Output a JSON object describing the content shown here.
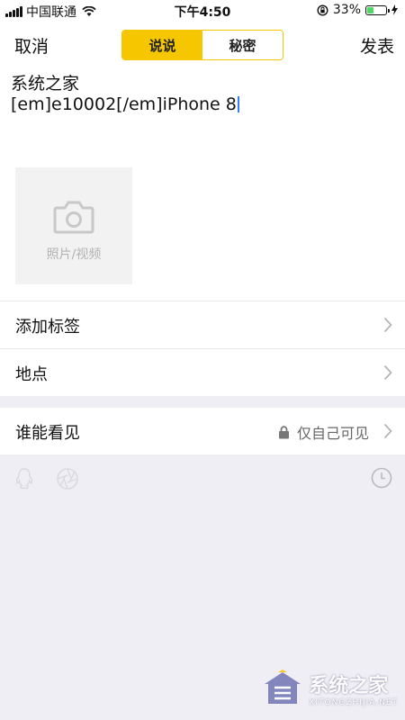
{
  "status_bar": {
    "carrier": "中国联通",
    "time": "下午4:50",
    "battery": "33%",
    "battery_level": 0.33
  },
  "nav": {
    "cancel": "取消",
    "publish": "发表",
    "tabs": [
      {
        "label": "说说"
      },
      {
        "label": "秘密"
      }
    ]
  },
  "compose": {
    "line1": "系统之家",
    "line2": "[em]e10002[/em]iPhone 8",
    "media_label": "照片/视频"
  },
  "rows": {
    "tags": {
      "label": "添加标签"
    },
    "location": {
      "label": "地点"
    },
    "visibility": {
      "label": "谁能看见",
      "value": "仅自己可见"
    }
  },
  "toolbar": {
    "icons": [
      "qq-icon",
      "aperture-icon",
      "clock-icon"
    ]
  },
  "watermark": {
    "cn": "系统之家",
    "en": "XITONGZHIJIA.NET"
  },
  "colors": {
    "accent": "#f6c700",
    "background": "#efeef4"
  }
}
